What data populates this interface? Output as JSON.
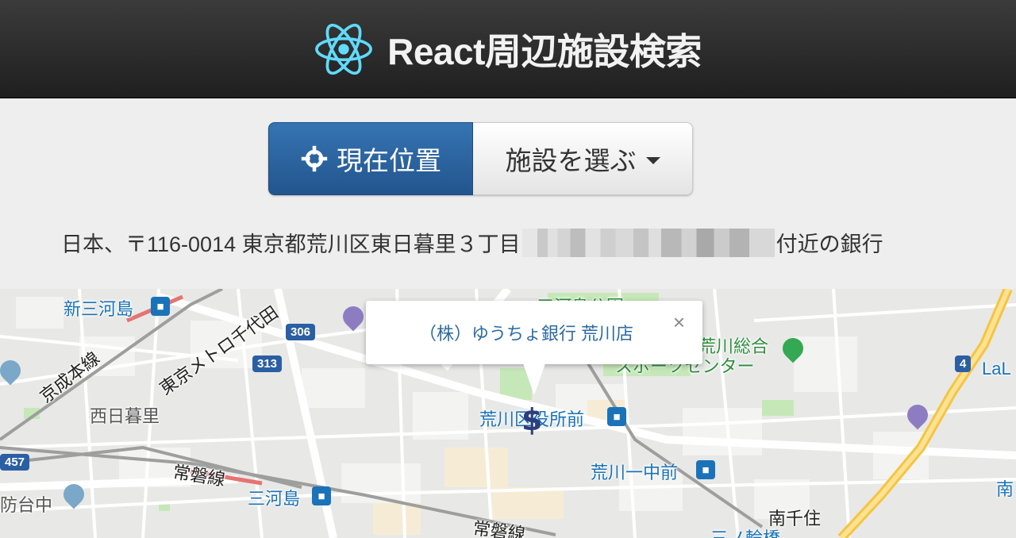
{
  "header": {
    "title": "React周辺施設検索",
    "logo_icon": "react-atom-icon"
  },
  "controls": {
    "current_location_label": "現在位置",
    "facility_select_label": "施設を選ぶ",
    "primary_color": "#2b62a0"
  },
  "address": {
    "prefix": "日本、〒116-0014 東京都荒川区東日暮里３丁目",
    "suffix": "付近の銀行"
  },
  "map": {
    "infowindow": {
      "title": "（株）ゆうちょ銀行 荒川店",
      "close_symbol": "×"
    },
    "marker_symbol": "$",
    "labels": {
      "station_1": "新三河島",
      "line_keisei": "京成本線",
      "line_metro": "東京メトロ千代田",
      "area_nishinippori": "西日暮里",
      "line_joban_1": "常磐線",
      "station_mikawashima": "三河島",
      "area_bochu": "防台中",
      "line_joban_2": "常磐線",
      "park": "三河島公園",
      "sports_center_1": "荒川総合",
      "sports_center_2": "スポーツセンター",
      "stop_ward_office": "荒川区役所前",
      "stop_arakawa_itchu": "荒川一中前",
      "area_minamisenju": "南千住",
      "stop_minowabashi": "三ノ輪橋",
      "edge_lal": "LaL",
      "edge_minami": "南",
      "route_306": "306",
      "route_313": "313",
      "route_457": "457",
      "route_4": "4"
    }
  }
}
